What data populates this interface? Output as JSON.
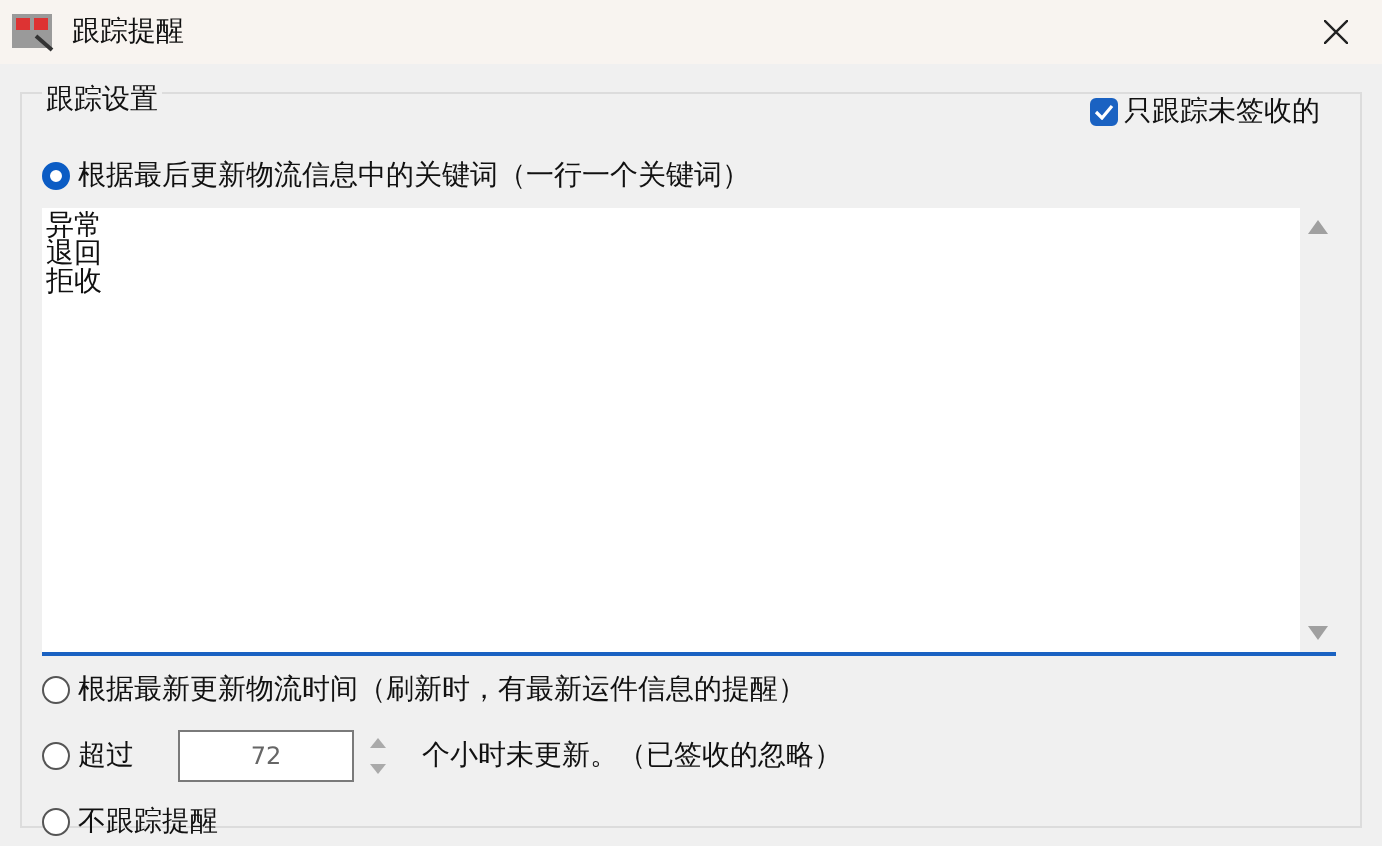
{
  "window": {
    "title": "跟踪提醒"
  },
  "group": {
    "title": "跟踪设置"
  },
  "only_unsigned": {
    "label": "只跟踪未签收的",
    "checked": true
  },
  "options": [
    {
      "kind": "keywords",
      "label": "根据最后更新物流信息中的关键词（一行一个关键词）",
      "selected": true,
      "keywords": [
        "异常",
        "退回",
        "拒收"
      ]
    },
    {
      "kind": "plain",
      "label": "根据最新更新物流时间（刷新时，有最新运件信息的提醒）",
      "selected": false
    },
    {
      "kind": "hours",
      "label": "超过",
      "value": "72",
      "suffix": "个小时未更新。（已签收的忽略）",
      "selected": false
    },
    {
      "kind": "plain",
      "label": "不跟踪提醒",
      "selected": false
    }
  ]
}
